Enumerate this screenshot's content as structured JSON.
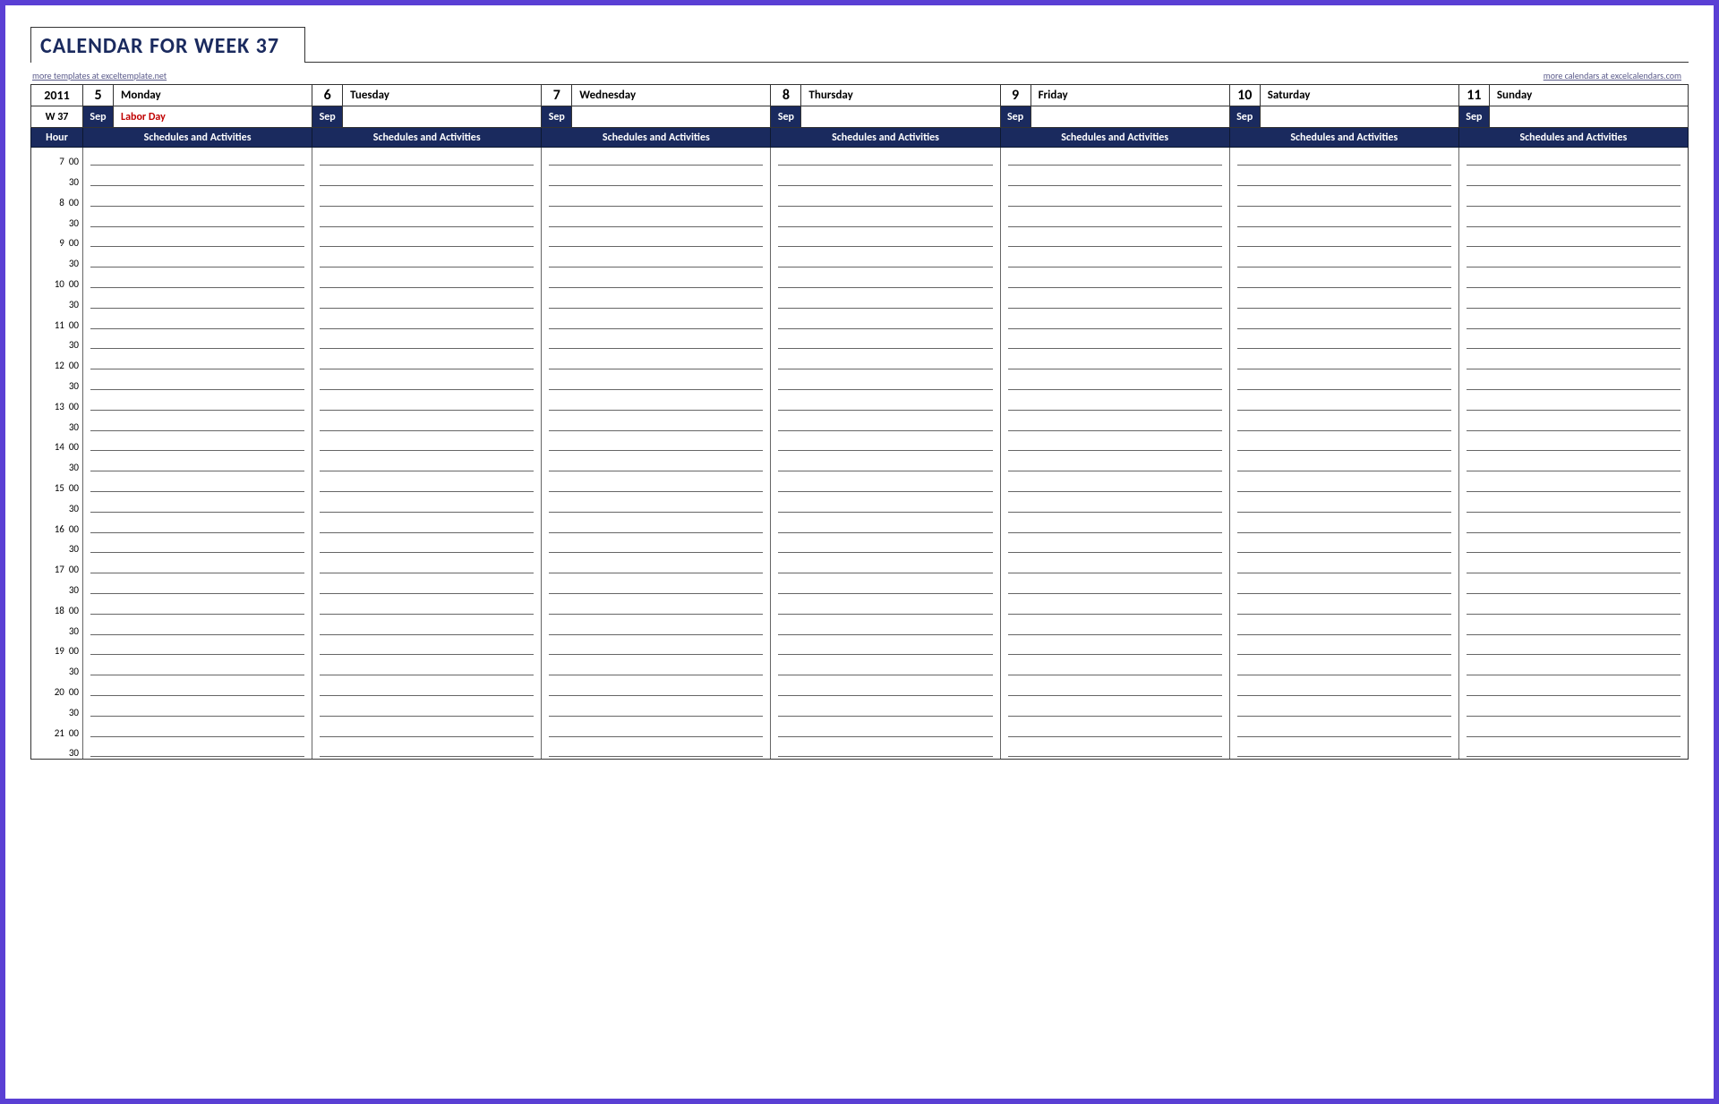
{
  "title": "CALENDAR FOR WEEK 37",
  "link_left": "more templates at exceltemplate.net",
  "link_right": "more calendars at excelcalendars.com",
  "year": "2011",
  "week_label": "W 37",
  "hour_header": "Hour",
  "activities_header": "Schedules and Activities",
  "days": [
    {
      "date": "5",
      "name": "Monday",
      "month": "Sep",
      "event": "Labor Day"
    },
    {
      "date": "6",
      "name": "Tuesday",
      "month": "Sep",
      "event": ""
    },
    {
      "date": "7",
      "name": "Wednesday",
      "month": "Sep",
      "event": ""
    },
    {
      "date": "8",
      "name": "Thursday",
      "month": "Sep",
      "event": ""
    },
    {
      "date": "9",
      "name": "Friday",
      "month": "Sep",
      "event": ""
    },
    {
      "date": "10",
      "name": "Saturday",
      "month": "Sep",
      "event": ""
    },
    {
      "date": "11",
      "name": "Sunday",
      "month": "Sep",
      "event": ""
    }
  ],
  "hours": [
    7,
    8,
    9,
    10,
    11,
    12,
    13,
    14,
    15,
    16,
    17,
    18,
    19,
    20,
    21
  ],
  "minute_labels": [
    "00",
    "30"
  ]
}
